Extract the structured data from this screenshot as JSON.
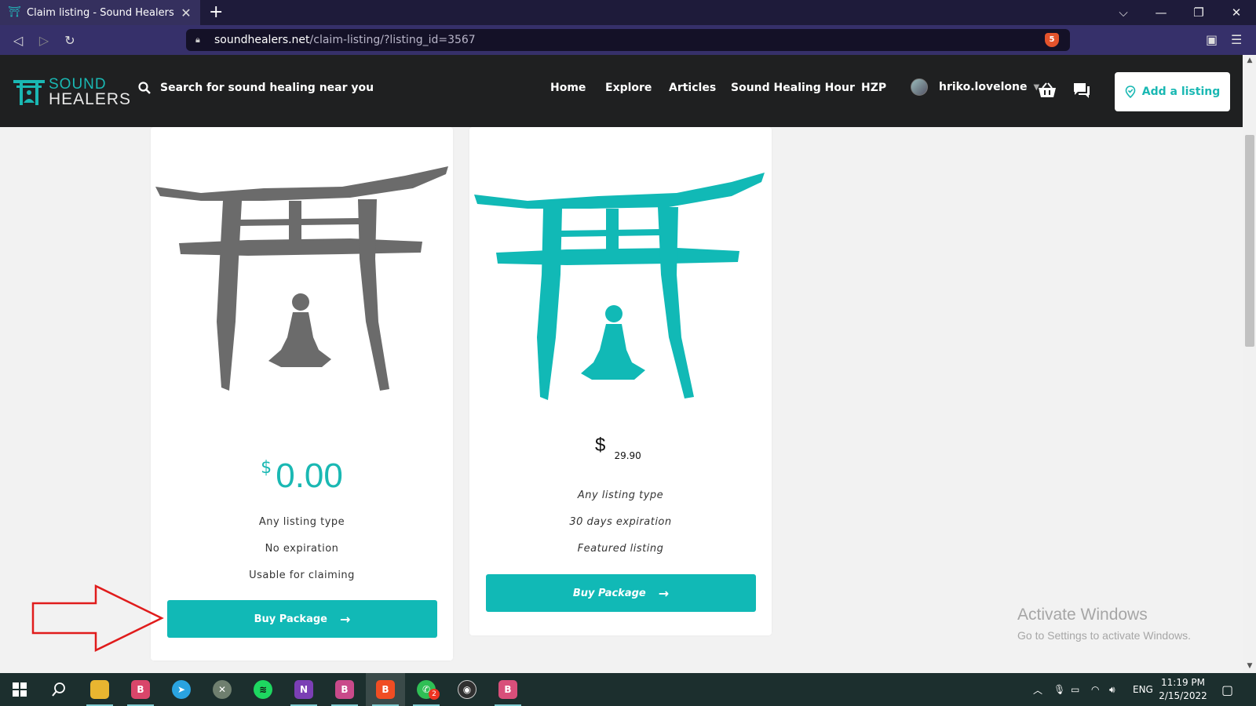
{
  "browser": {
    "tab_title": "Claim listing - Sound Healers",
    "url_host": "soundhealers.net",
    "url_path": "/claim-listing/?listing_id=3567",
    "shield_count": "5"
  },
  "site": {
    "logo_line1": "SOUND",
    "logo_line2": "HEALERS",
    "search_placeholder": "Search for sound healing near you",
    "nav": [
      "Home",
      "Explore",
      "Articles",
      "Sound Healing Hour",
      "HZP"
    ],
    "username": "hriko.lovelone",
    "add_listing_label": "Add a listing",
    "accent_color": "#1ab8b3"
  },
  "packages": [
    {
      "currency": "$",
      "price": "0.00",
      "features": [
        "Any listing type",
        "No expiration",
        "Usable for claiming"
      ],
      "button_label": "Buy Package",
      "art_color": "#6b6b6b"
    },
    {
      "currency": "$",
      "price": "29.90",
      "features": [
        "Any listing type",
        "30 days expiration",
        "Featured listing"
      ],
      "button_label": "Buy Package",
      "art_color": "#11b9b6"
    }
  ],
  "watermark": {
    "title": "Activate Windows",
    "subtitle": "Go to Settings to activate Windows."
  },
  "taskbar": {
    "language": "ENG",
    "time": "11:19 PM",
    "date": "2/15/2022",
    "whatsapp_badge": "2",
    "onenote_letter": "N"
  }
}
